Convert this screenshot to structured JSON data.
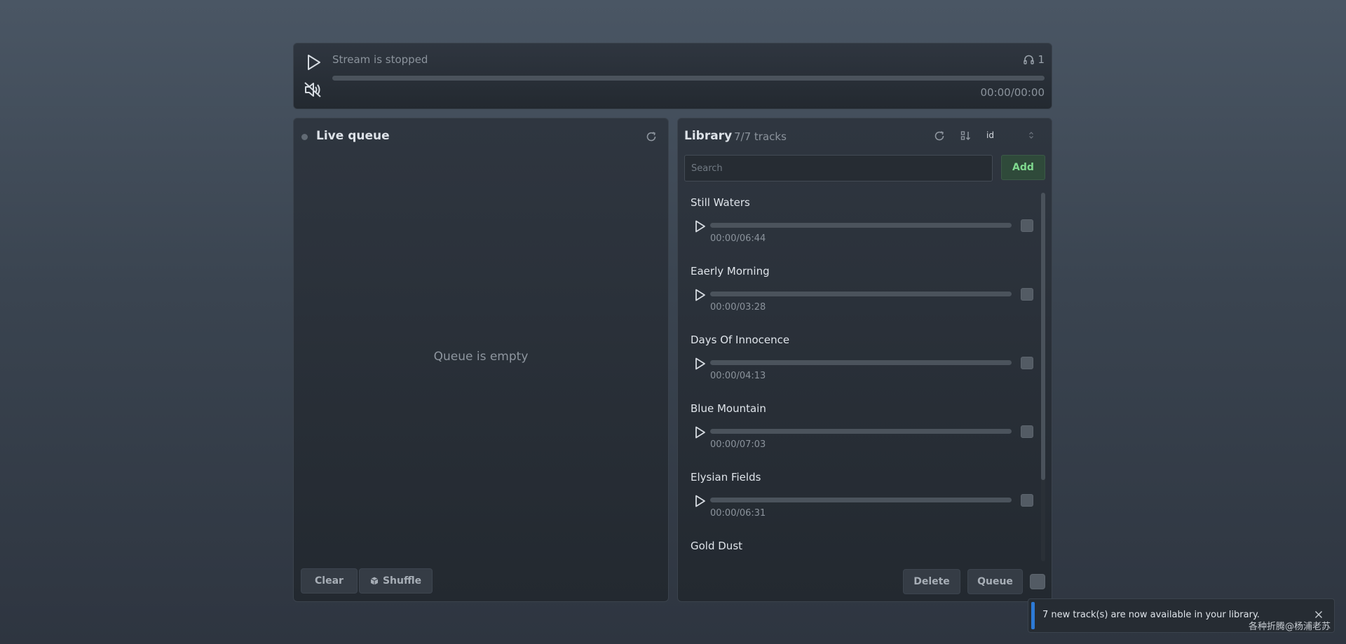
{
  "player": {
    "status": "Stream is stopped",
    "listeners": "1",
    "time": "00:00/00:00",
    "progress": 0
  },
  "queue": {
    "title": "Live queue",
    "empty_text": "Queue is empty",
    "clear_label": "Clear",
    "shuffle_label": "Shuffle"
  },
  "library": {
    "title": "Library",
    "count": "7/7 tracks",
    "sort_field": "id",
    "search_placeholder": "Search",
    "add_label": "Add",
    "delete_label": "Delete",
    "queue_label": "Queue",
    "tracks": [
      {
        "title": "Still Waters",
        "time": "00:00/06:44"
      },
      {
        "title": "Eaerly Morning",
        "time": "00:00/03:28"
      },
      {
        "title": "Days Of Innocence",
        "time": "00:00/04:13"
      },
      {
        "title": "Blue Mountain",
        "time": "00:00/07:03"
      },
      {
        "title": "Elysian Fields",
        "time": "00:00/06:31"
      },
      {
        "title": "Gold Dust",
        "time": ""
      }
    ]
  },
  "toast": {
    "message": "7 new track(s) are now available in your library."
  },
  "watermark": "各种折腾@杨浦老苏",
  "colors": {
    "accent_green": "#7fd98e",
    "toast_accent": "#2d7ad6"
  }
}
